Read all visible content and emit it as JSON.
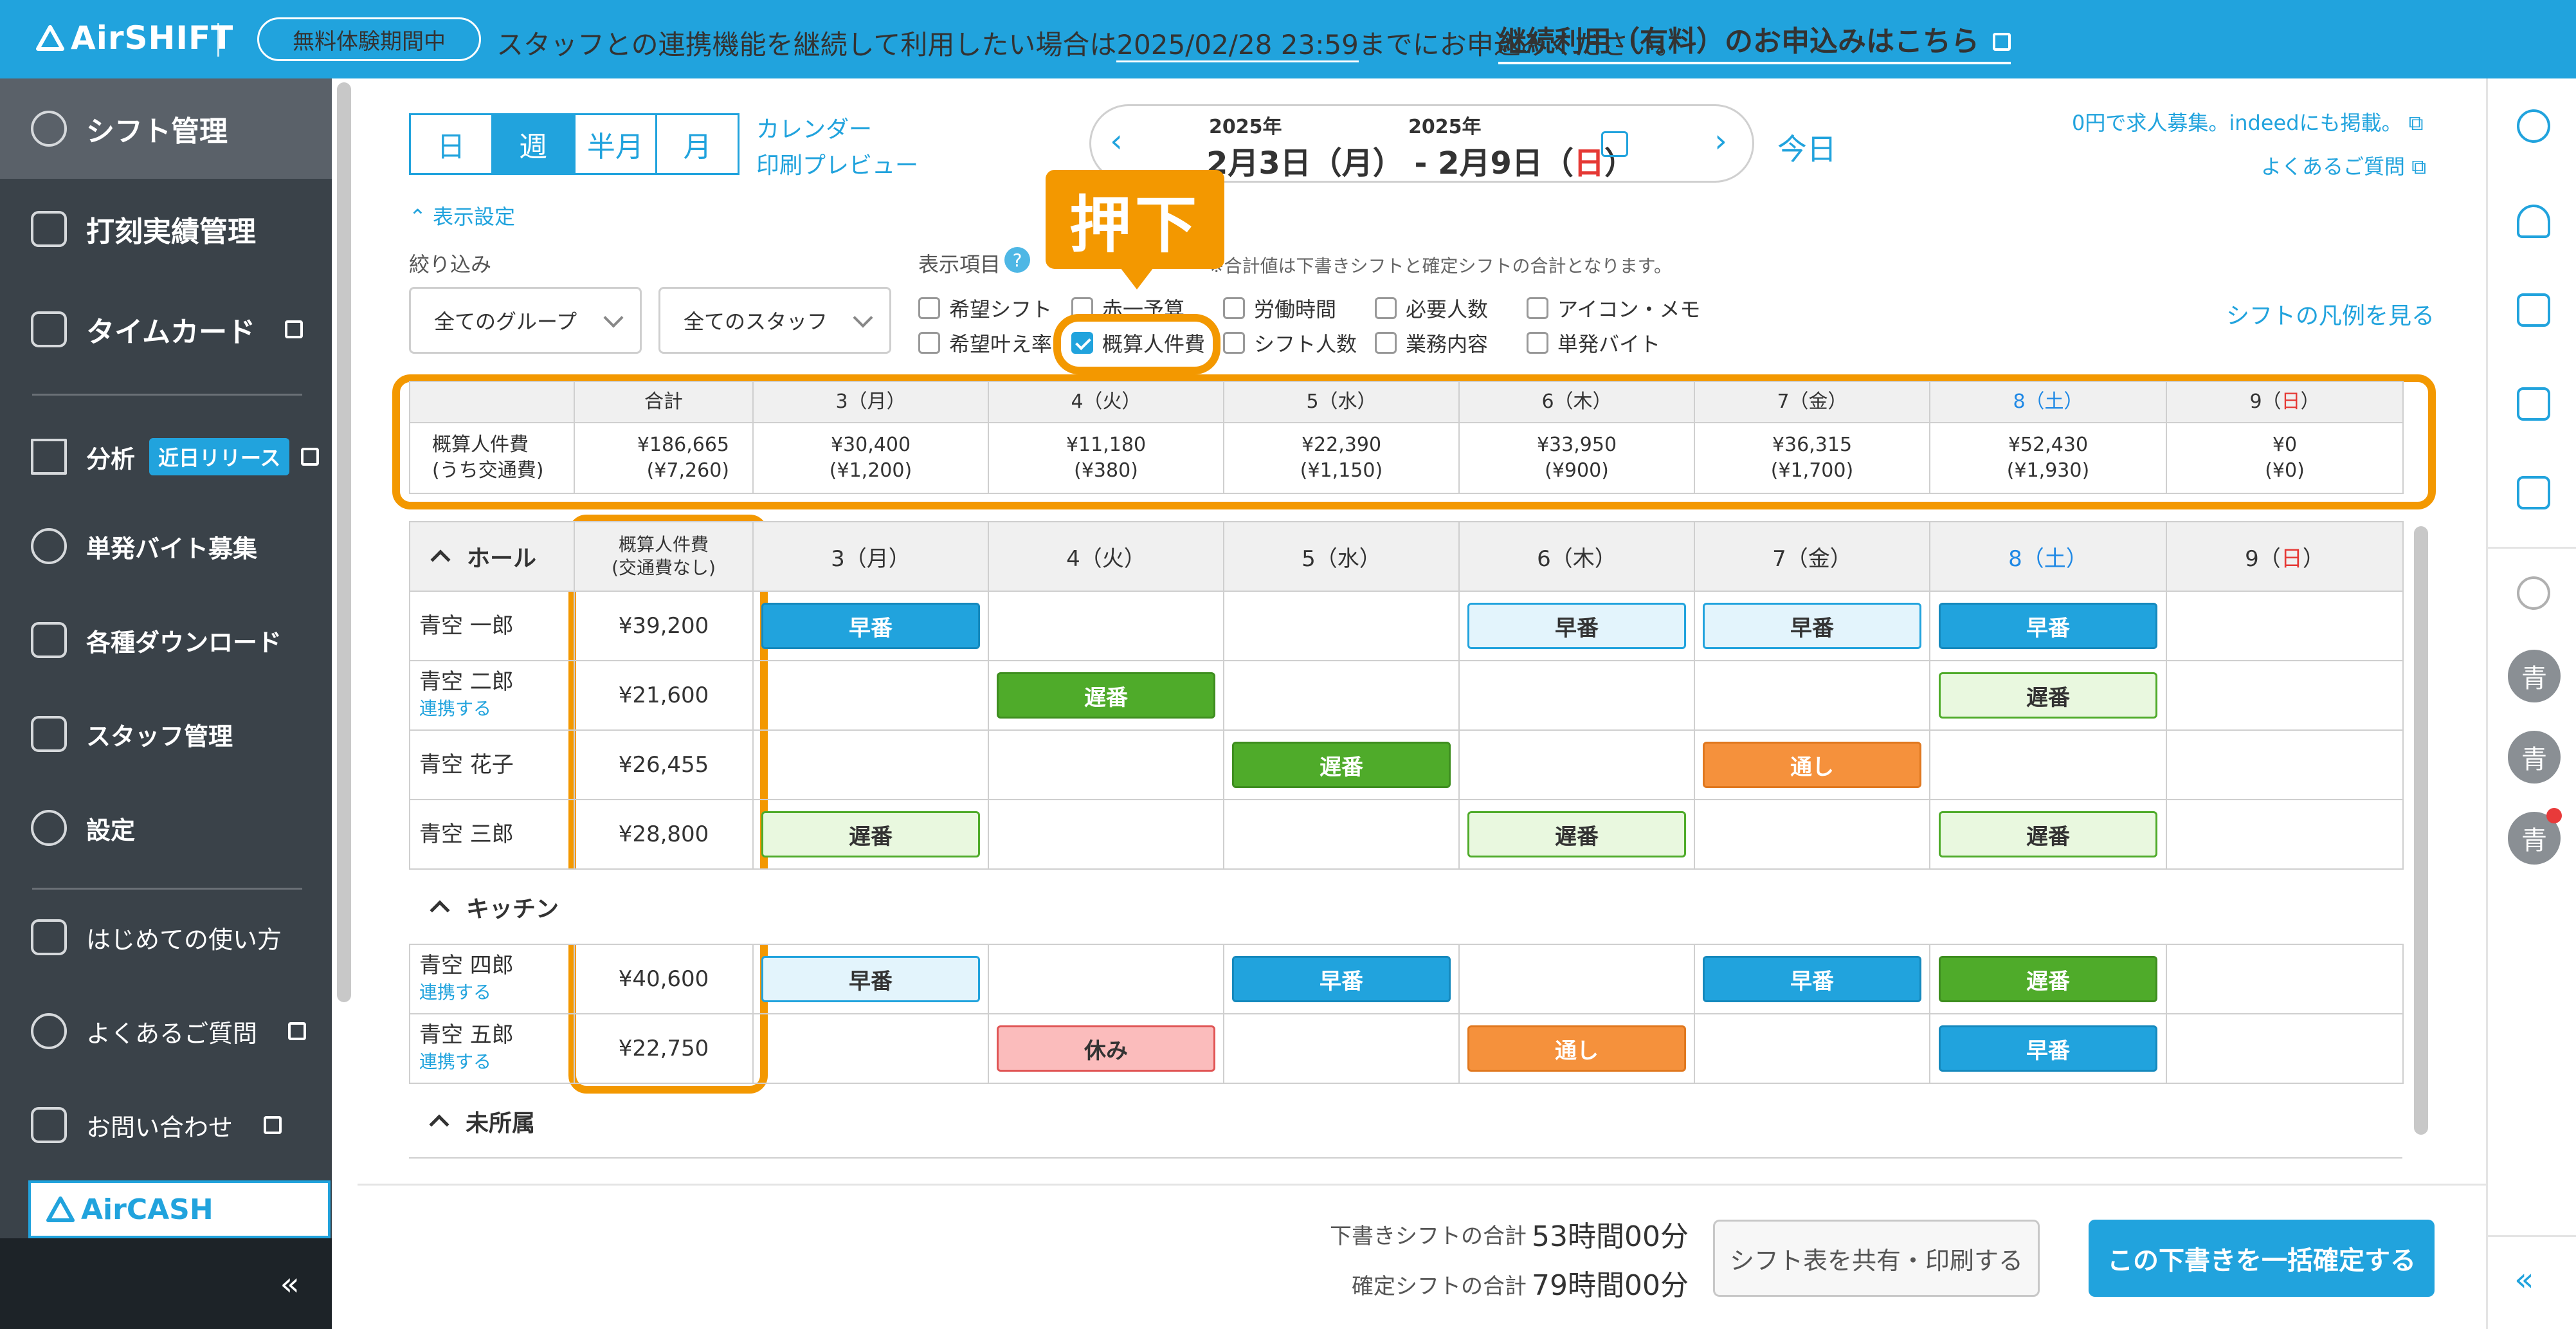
{
  "banner": {
    "logo": "AirSHIFT",
    "trial_badge": "無料体験期間中",
    "message_prefix": "スタッフとの連携機能を継続して利用したい場合は",
    "deadline": "2025/02/28 23:59",
    "message_suffix": "までにお申込みください。",
    "cta_link": "継続利用（有料）のお申込みはこちら"
  },
  "sidebar": {
    "items": [
      {
        "label": "シフト管理",
        "icon": "shift-icon"
      },
      {
        "label": "打刻実績管理",
        "icon": "timesheet-icon"
      },
      {
        "label": "タイムカード",
        "icon": "timecard-icon"
      },
      {
        "label": "分析",
        "badge": "近日リリース",
        "icon": "chart-icon"
      },
      {
        "label": "単発バイト募集",
        "icon": "recruit-icon"
      },
      {
        "label": "各種ダウンロード",
        "icon": "download-icon"
      },
      {
        "label": "スタッフ管理",
        "icon": "staff-icon"
      },
      {
        "label": "設定",
        "icon": "gear-icon"
      },
      {
        "label": "はじめての使い方",
        "icon": "guide-icon"
      },
      {
        "label": "よくあるご質問",
        "icon": "question-icon"
      },
      {
        "label": "お問い合わせ",
        "icon": "mail-icon"
      }
    ],
    "aircash_label": "AirCASH",
    "collapse_label": "«"
  },
  "header": {
    "views": [
      "日",
      "週",
      "半月",
      "月"
    ],
    "active_view": "週",
    "calendar_link": "カレンダー",
    "print_preview_link": "印刷プレビュー",
    "date_start_year": "2025年",
    "date_end_year": "2025年",
    "date_start": "2月3日（月）",
    "date_sep": " - ",
    "date_end_prefix": "2月9日（",
    "date_end_day": "日",
    "date_end_suffix": "）",
    "today_label": "今日",
    "indeed_link": "0円で求人募集。indeedにも掲載。",
    "faq_link": "よくあるご質問"
  },
  "settings": {
    "toggle_label": "表示設定",
    "filter_label": "絞り込み",
    "group_select": "全てのグループ",
    "staff_select": "全てのスタッフ",
    "display_items_label": "表示項目",
    "help_mark": "?",
    "note": "※合計値は下書きシフトと確定シフトの合計となります。",
    "legend_link": "シフトの凡例を見る",
    "checkboxes": [
      {
        "label": "希望シフト",
        "checked": false
      },
      {
        "label": "赤一予算",
        "checked": false
      },
      {
        "label": "労働時間",
        "checked": false
      },
      {
        "label": "必要人数",
        "checked": false
      },
      {
        "label": "アイコン・メモ",
        "checked": false
      },
      {
        "label": "希望叶え率",
        "checked": false
      },
      {
        "label": "概算人件費",
        "checked": true
      },
      {
        "label": "シフト人数",
        "checked": false
      },
      {
        "label": "業務内容",
        "checked": false
      },
      {
        "label": "単発バイト",
        "checked": false
      }
    ]
  },
  "callout": {
    "label": "押下",
    "color": "#f39800"
  },
  "summary": {
    "headers": [
      "",
      "合計",
      "3（月）",
      "4（火）",
      "5（水）",
      "6（木）",
      "7（金）",
      "8（土）",
      "9（日）"
    ],
    "row_label_1": "概算人件費",
    "row_label_2": "(うち交通費)",
    "totals": [
      "¥186,665",
      "¥30,400",
      "¥11,180",
      "¥22,390",
      "¥33,950",
      "¥36,315",
      "¥52,430",
      "¥0"
    ],
    "transport": [
      "(¥7,260)",
      "(¥1,200)",
      "(¥380)",
      "(¥1,150)",
      "(¥900)",
      "(¥1,700)",
      "(¥1,930)",
      "(¥0)"
    ]
  },
  "shift_table": {
    "cost_header_1": "概算人件費",
    "cost_header_2": "(交通費なし)",
    "days": [
      "3（月）",
      "4（火）",
      "5（水）",
      "6（木）",
      "7（金）",
      "8（土）",
      "9（日）"
    ],
    "groups": [
      {
        "name": "ホール",
        "staff": [
          {
            "name": "青空 一郎",
            "link": "",
            "cost": "¥39,200",
            "shifts": [
              [
                "早番",
                "early"
              ],
              null,
              null,
              [
                "早番",
                "early-l"
              ],
              [
                "早番",
                "early-l"
              ],
              [
                "早番",
                "early"
              ],
              null
            ]
          },
          {
            "name": "青空 二郎",
            "link": "連携する",
            "cost": "¥21,600",
            "shifts": [
              null,
              [
                "遅番",
                "late"
              ],
              null,
              null,
              null,
              [
                "遅番",
                "late-l"
              ],
              null
            ]
          },
          {
            "name": "青空 花子",
            "link": "",
            "cost": "¥26,455",
            "shifts": [
              null,
              null,
              [
                "遅番",
                "late"
              ],
              null,
              [
                "通し",
                "full"
              ],
              null,
              null
            ]
          },
          {
            "name": "青空 三郎",
            "link": "",
            "cost": "¥28,800",
            "shifts": [
              [
                "遅番",
                "late-l"
              ],
              null,
              null,
              [
                "遅番",
                "late-l"
              ],
              null,
              [
                "遅番",
                "late-l"
              ],
              null
            ]
          }
        ]
      },
      {
        "name": "キッチン",
        "staff": [
          {
            "name": "青空 四郎",
            "link": "連携する",
            "cost": "¥40,600",
            "shifts": [
              [
                "早番",
                "early-l"
              ],
              null,
              [
                "早番",
                "early"
              ],
              null,
              [
                "早番",
                "early"
              ],
              [
                "遅番",
                "late"
              ],
              null
            ]
          },
          {
            "name": "青空 五郎",
            "link": "連携する",
            "cost": "¥22,750",
            "shifts": [
              null,
              [
                "休み",
                "off"
              ],
              null,
              [
                "通し",
                "full"
              ],
              null,
              [
                "早番",
                "early"
              ],
              null
            ]
          }
        ]
      }
    ],
    "unassigned_label": "未所属"
  },
  "footer": {
    "draft_label": "下書きシフトの合計",
    "draft_value": "53時間00分",
    "confirmed_label": "確定シフトの合計",
    "confirmed_value": "79時間00分",
    "share_button": "シフト表を共有・印刷する",
    "confirm_button": "この下書きを一括確定する"
  },
  "rightrail": {
    "avatars": [
      "青",
      "青",
      "青"
    ],
    "collapse_label": "«"
  }
}
